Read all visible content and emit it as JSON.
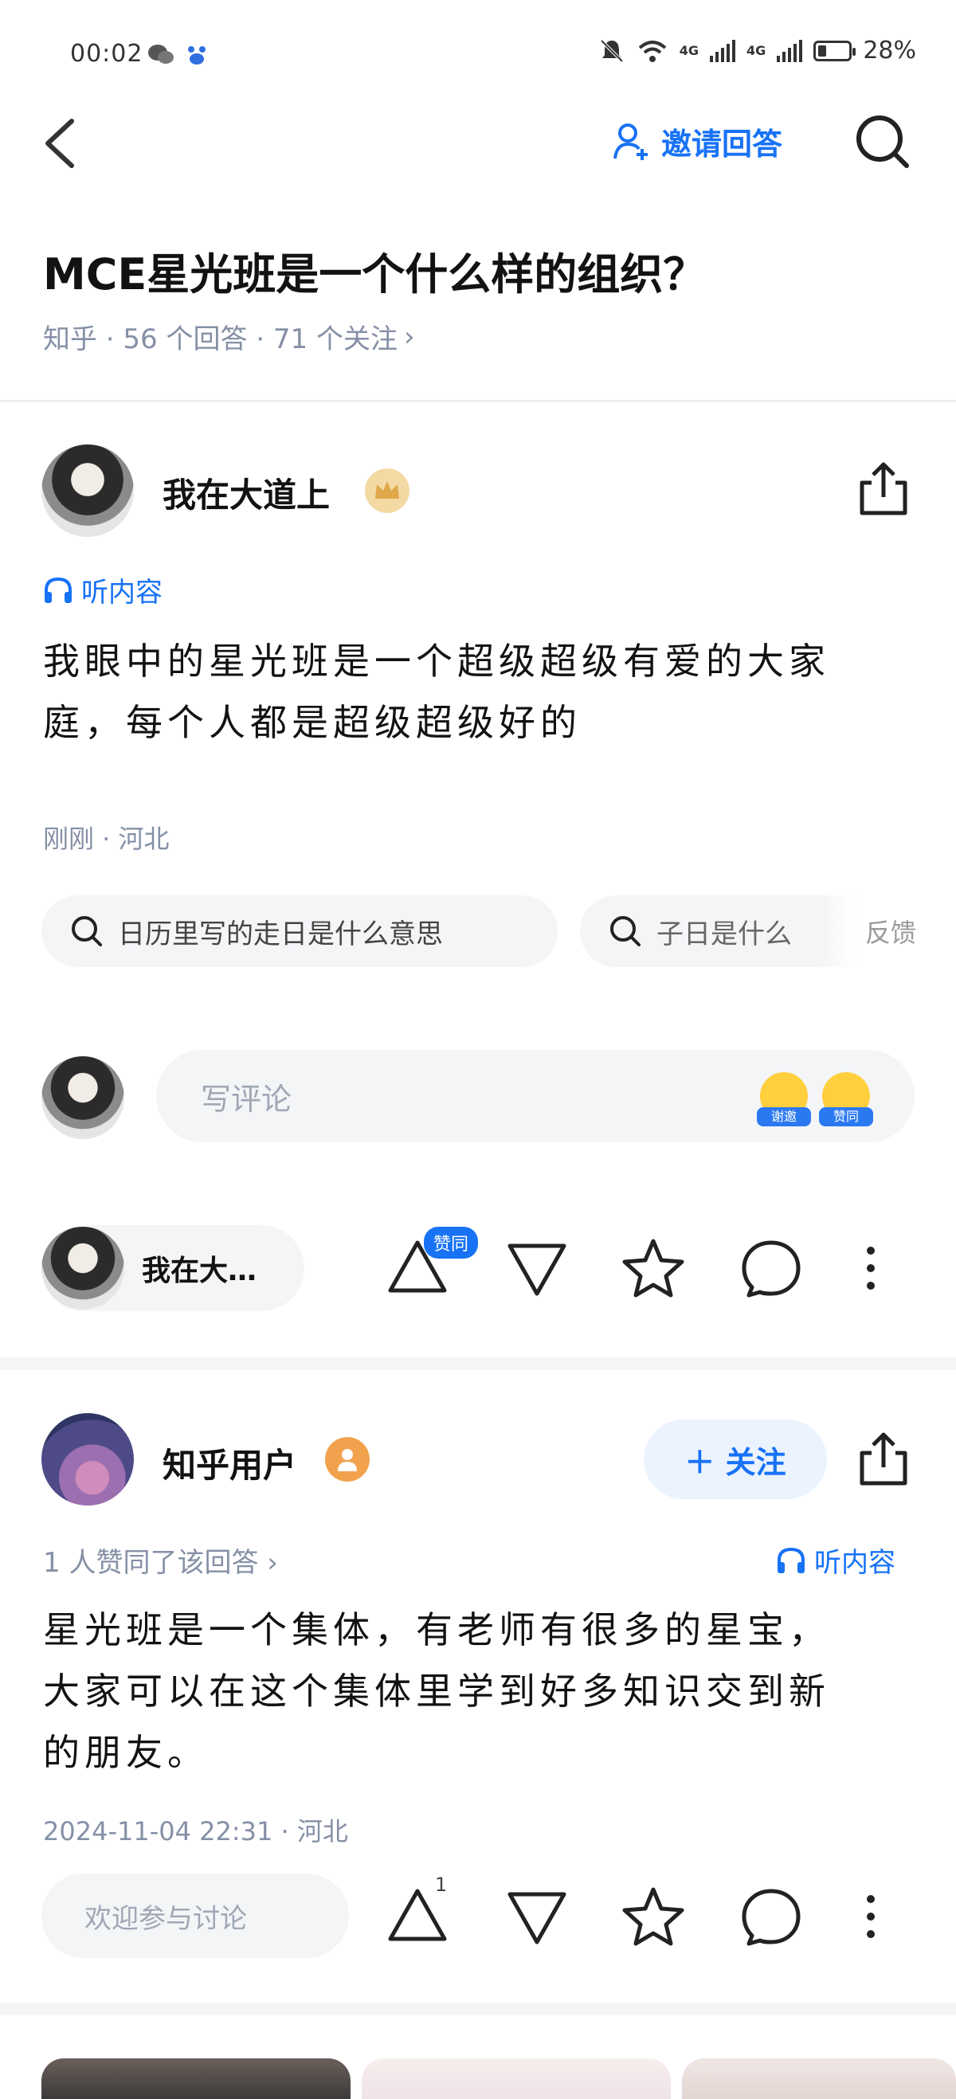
{
  "status_bar": {
    "time": "00:02",
    "network_1": "4G",
    "network_2": "4G",
    "battery": "28%",
    "battery_level": 0.28
  },
  "header": {
    "invite_label": "邀请回答"
  },
  "question": {
    "title": "MCE星光班是一个什么样的组织？",
    "meta": "知乎 · 56 个回答 · 71 个关注",
    "meta_arrow": "›"
  },
  "answer1": {
    "author": "我在大道上",
    "listen_label": "听内容",
    "text_line1": "我眼中的星光班是一个超级超级有爱的大家",
    "text_line2": "庭，每个人都是超级超级好的",
    "meta": "刚刚 · 河北",
    "related_searches": [
      "日历里写的走日是什么意思",
      "子日是什么"
    ],
    "feedback_label": "反馈",
    "comment_placeholder": "写评论",
    "emoji_1": "谢邀",
    "emoji_2": "赞同",
    "author_short": "我在大…",
    "upvote_badge": "赞同"
  },
  "answer2": {
    "author": "知乎用户",
    "follow_label": "＋ 关注",
    "upvote_info": "1 人赞同了该回答 ›",
    "listen_label": "听内容",
    "text_line1": "星光班是一个集体，有老师有很多的星宝，",
    "text_line2": "大家可以在这个集体里学到好多知识交到新",
    "text_line3": "的朋友。",
    "meta": "2024-11-04 22:31 · 河北",
    "discuss_placeholder": "欢迎参与讨论",
    "upvote_count": "1"
  },
  "colors": {
    "accent": "#1772f6",
    "gray_text": "#8590a6",
    "bg_soft": "#f4f5f7"
  },
  "icons": [
    "back-icon",
    "invite-user-icon",
    "search-icon",
    "share-icon",
    "headphones-icon",
    "upvote-icon",
    "downvote-icon",
    "star-icon",
    "comment-icon",
    "more-icon"
  ]
}
